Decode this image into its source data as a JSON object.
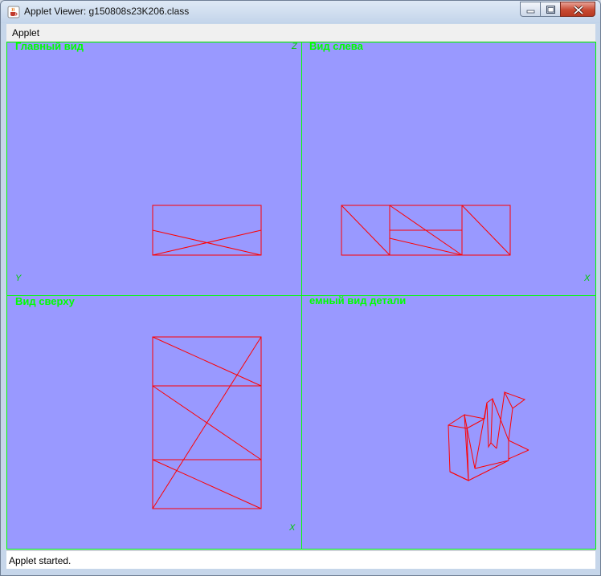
{
  "window": {
    "title": "Applet Viewer: g150808s23K206.class"
  },
  "menu": {
    "applet_label": "Applet"
  },
  "views": {
    "front": {
      "label": "Главный вид",
      "axis_h": "Y",
      "axis_v": "Z"
    },
    "left": {
      "label": "Вид слева",
      "axis_h": "X"
    },
    "top": {
      "label": "Вид сверху",
      "axis_v": "X"
    },
    "iso": {
      "label": "емный вид детали"
    }
  },
  "status": {
    "text": "Applet started."
  },
  "colors": {
    "canvas": "#9999ff",
    "wire": "#ff0000",
    "grid": "#00ff00",
    "label": "#00ff00"
  },
  "icons": {
    "app": "java-cup-icon",
    "minimize": "minimize-icon",
    "maximize": "maximize-icon",
    "close": "close-icon"
  }
}
